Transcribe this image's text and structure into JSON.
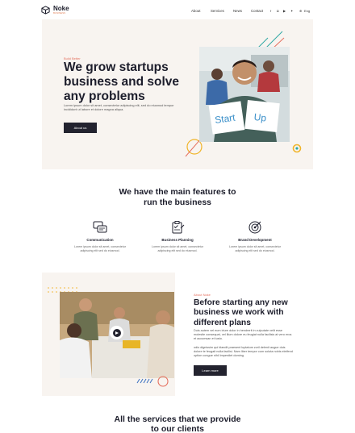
{
  "header": {
    "brand": "Noke",
    "tagline": "BUSINESS",
    "nav": [
      "About",
      "Services",
      "News",
      "Contact"
    ],
    "social_icons": [
      "facebook-icon",
      "instagram-icon",
      "youtube-icon",
      "twitter-icon"
    ],
    "language": "Eng"
  },
  "hero": {
    "label": "Build Better",
    "title": "We grow startups business and solve any problems",
    "text": "Lorem ipsum dolor sit amet, consectetur adipiscing elit, sed do eiusmod tempor incididunt ut labore et dolore magna aliqua.",
    "button": "About us",
    "sign_left": "Start",
    "sign_right": "Up"
  },
  "features": {
    "title_line1": "We have the main features to",
    "title_line2": "run the business",
    "items": [
      {
        "name": "Communication",
        "icon": "chat-bubbles-icon",
        "desc": "Lorem ipsum dolor sit amet, consectetur adipiscing elit sed do eiusmod."
      },
      {
        "name": "Business Planning",
        "icon": "clipboard-icon",
        "desc": "Lorem ipsum dolor sit amet, consectetur adipiscing elit sed do eiusmod."
      },
      {
        "name": "Brand Development",
        "icon": "target-icon",
        "desc": "Lorem ipsum dolor sit amet, consectetur adipiscing elit sed do eiusmod."
      }
    ]
  },
  "about": {
    "label": "About Noke",
    "title": "Before starting any new business we work with different plans",
    "text1": "Duis autem vel eum iriure dolor in hendrerit in vulputate velit esse molestie consequat, vel illum dolore eu feugiat nulla facilisis at vero eros et accumsan et iusto.",
    "text2": "odio dignissim qui blandit praesent luptatum zzril delenit augue duis dolore te feugait nulla facilisi. Nam liber tempor cum soluta nobis eleifend option congue nihil imperdiet doming.",
    "button": "Learn more"
  },
  "services": {
    "title_line1": "All the services that we provide",
    "title_line2": "to our clients"
  },
  "colors": {
    "accent": "#e57160",
    "dark": "#23232f",
    "panel": "#f8f4f0",
    "teal": "#2fa8a4",
    "yellow": "#f0b429"
  }
}
